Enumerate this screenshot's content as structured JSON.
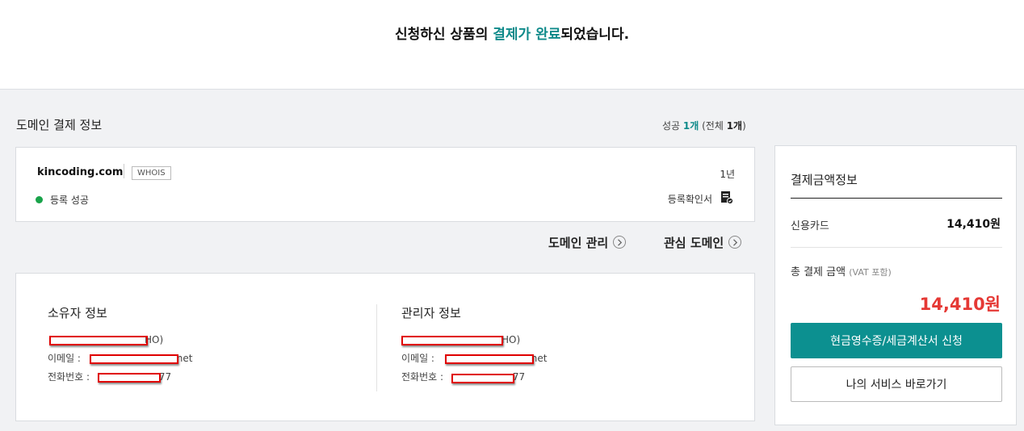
{
  "header": {
    "headline_pre": "신청하신 상품의 ",
    "headline_highlight": "결제가 완료",
    "headline_post": "되었습니다."
  },
  "domain_section": {
    "title": "도메인 결제 정보",
    "count": {
      "success_label": "성공 ",
      "success_num": "1개",
      "total_label": " (전체 ",
      "total_num": "1개",
      "close": ")"
    },
    "item": {
      "domain": "kincoding.com",
      "whois_label": "WHOIS",
      "period": "1년",
      "status": "등록 성공",
      "confirm_label": "등록확인서"
    },
    "status_color": "#19a34a"
  },
  "links": {
    "domain_manage": "도메인 관리",
    "interest_domain": "관심 도메인"
  },
  "contacts": {
    "owner": {
      "title": "소유자 정보",
      "name_suffix": "HO)",
      "email_label": "이메일 : ",
      "email_suffix": "net",
      "phone_label": "전화번호 : ",
      "phone_suffix": "77"
    },
    "admin": {
      "title": "관리자 정보",
      "name_suffix": "HO)",
      "email_label": "이메일 : ",
      "email_suffix": "net",
      "phone_label": "전화번호 : ",
      "phone_suffix": "77"
    }
  },
  "payment": {
    "title": "결제금액정보",
    "method": "신용카드",
    "method_amount": "14,410원",
    "total_label": "총 결제 금액",
    "vat_note": "(VAT 포함)",
    "total_amount": "14,410원",
    "receipt_button": "현금영수증/세금계산서 신청",
    "my_service_button": "나의 서비스 바로가기"
  },
  "colors": {
    "accent": "#0c9090",
    "total_red": "#e53935",
    "redact": "#e00000"
  }
}
